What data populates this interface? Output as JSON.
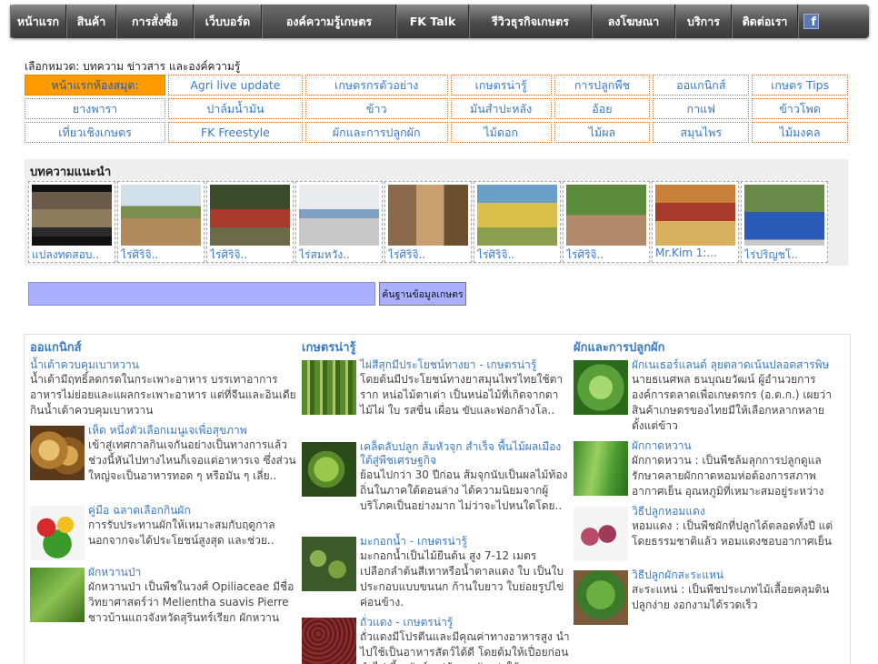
{
  "nav": {
    "items": [
      "หน้าแรก",
      "สินค้า",
      "การสั่งซื้อ",
      "เว็บบอร์ด",
      "องค์ความรู้เกษตร",
      "FK Talk",
      "รีวิวธุรกิจเกษตร",
      "ลงโฆษณา",
      "บริการ",
      "ติดต่อเรา"
    ],
    "facebook_icon": "facebook-icon"
  },
  "categories": {
    "title": "เลือกหมวด: บทความ ข่าวสาร และองค์ความรู้",
    "rows": [
      [
        "หน้าแรกห้องสมุด:",
        "Agri live update",
        "เกษตรกรตัวอย่าง",
        "เกษตรน่ารู้",
        "การปลูกพืช",
        "ออแกนิกส์",
        "เกษตร Tips"
      ],
      [
        "ยางพารา",
        "ปาล์มน้ำมัน",
        "ข้าว",
        "มันสำปะหลัง",
        "อ้อย",
        "กาแฟ",
        "ข้าวโพด"
      ],
      [
        "เที่ยวเชิงเกษตร",
        "FK Freestyle",
        "ผักและการปลูกผัก",
        "ไม้ดอก",
        "ไม้ผล",
        "สมุนไพร",
        "ไม้มงคล"
      ]
    ]
  },
  "recommended": {
    "title": "บทความแนะนำ",
    "items": [
      "แปลงทดสอบ..",
      "ไร่ศิริจิ..",
      "ไร่ศิริจิ..",
      "ไร่สมหวัง..",
      "ไร่ศิริจิ..",
      "ไร่ศิริจิ..",
      "ไร่ศิริจิ..",
      "Mr.Kim 1:...",
      "ไร่ปริญชโ.."
    ]
  },
  "search": {
    "value": "",
    "button_label": "ค้นฐานข้อมูลเกษตร"
  },
  "columns": [
    {
      "title": "ออแกนิกส์",
      "items": [
        {
          "title": "น้ำเต้าควบคุมเบาหวาน",
          "text": "น้ำเต้ามีฤทธิ์ลดกรดในกระเพาะอาหาร บรรเทาอาการอาหารไม่ย่อยและแผลกระเพาะอาหาร แต่ที่จีนและอินเดียกินน้ำเต้าควบคุมเบาหวาน",
          "image": ""
        },
        {
          "title": "เห็ด หนึ่งตัวเลือกเมนูเจเพื่อสุขภาพ",
          "text": "เข้าสู่เทศกาลกินเจกันอย่างเป็นทางการแล้วช่วงนี้หันไปทางไหนก็เจอแต่อาหารเจ ซึ่งส่วนใหญ่จะเป็นอาหารทอด ๆ หรือมัน ๆ เลี่ย..",
          "image": "mushroom-photo"
        },
        {
          "title": "คู่มือ ฉลาดเลือกกินผัก",
          "text": "การรับประทานผักให้เหมาะสมกับฤดูกาลนอกจากจะได้ประโยชน์สูงสุด และช่วย..",
          "image": "vegetables-photo"
        },
        {
          "title": "ผักหวานป่า",
          "text": "ผักหวานป่า เป็นพืชในวงศ์ Opiliaceae มีชื่อวิทยาศาสตร์ว่า Melientha suavis Pierre ชาวบ้านแถวจังหวัดสุรินทร์เรียก ผักหวาน",
          "image": "wild-sweet-leaf-photo"
        }
      ]
    },
    {
      "title": "เกษตรน่ารู้",
      "items": [
        {
          "title": "ไผ่สีสุกมีประโยชน์ทางยา - เกษตรน่ารู้",
          "text": "โดยต้นมีประโยชน์ทางยาสมุนไพรไทยใช้ตา ราก หน่อไม้ตาเต่า เป็นหน่อไม้ที่เกิดจากตาไม้ไผ่ ใบ รสขื่น เผื่อน ขับและฟอกล้างโล..",
          "image": "bamboo-photo"
        },
        {
          "title": "เคล็ดลับปลูก ส้มหัวจุก สำเร็จ พื้นไม้ผลเมืองใต้สู่พืชเศรษฐกิจ",
          "text": "ย้อนไปกว่า 30 ปีก่อน ส้มจุกนับเป็นผลไม้ท้องถิ่นในภาคใต้ตอนล่าง ได้ความนิยมจากผู้บริโภคเป็นอย่างมาก ไม่ว่าจะไปหนใดโดย..",
          "image": "green-orange-photo"
        },
        {
          "title": "มะกอกน้ำ - เกษตรน่ารู้",
          "text": "มะกอกน้ำเป็นไม้ยืนต้น สูง 7-12 เมตร เปลือกลำต้นสีเทาหรือน้ำตาลแดง ใบ เป็นใบประกอบแบบขนนก ก้านใบยาว ใบย่อยรูปไข่ค่อนข้าง.",
          "image": "olive-photo"
        },
        {
          "title": "ถั่วแดง - เกษตรน่ารู้",
          "text": "ถั่วแดงมีโปรตีนและมีคุณค่าทางอาหารสูง นำไปใช้เป็นอาหารสัตว์ได้ดี โดยต้มให้เปื่อยก่อนนำไปเลี้ยงสัตว์ แต่ต้องระวังอย่าให้",
          "image": "red-bean-photo"
        }
      ]
    },
    {
      "title": "ผักและการปลูกผัก",
      "items": [
        {
          "title": "ผักเนเธอร์แลนด์ ลุยตลาดเน้นปลอดสารพิษ",
          "text": "นายธเนศพล ธนบุณยวัฒน์ ผู้อำนวยการองค์การตลาดเพื่อเกษตรกร (อ.ต.ก.) เผยว่า สินค้าเกษตรของไทยมีให้เลือกหลากหลาย ตั้งแต่ข้าว",
          "image": "lettuce-photo"
        },
        {
          "title": "ผักกาดหวาน",
          "text": "ผักกาดหวาน : เป็นพืชล้มลุกการปลูกดูแลรักษาคลายผักกาดหอมห่อต้องการสภาพอากาศเย็น อุณหภูมิที่เหมาะสมอยู่ระหว่าง",
          "image": "romaine-photo"
        },
        {
          "title": "วิธีปลูกหอมแดง",
          "text": "หอมแดง : เป็นพืชผักที่ปลูกได้ตลอดทั้งปี แต่โดยธรรมชาติแล้ว หอมแดงชอบอากาศเย็น",
          "image": "shallot-photo"
        },
        {
          "title": "วิธีปลูกผักสะระแหน่",
          "text": "สะระแหน่ : เป็นพืชประเภทไม้เลื้อยคลุมดิน ปลูกง่าย งอกงามได้รวดเร็ว",
          "image": "mint-photo"
        }
      ]
    }
  ],
  "colors": {
    "nav_bg": "#4a4a4a",
    "link": "#3a7ac8",
    "category_active": "#ff9a00",
    "search_bg": "#aab0ff"
  }
}
